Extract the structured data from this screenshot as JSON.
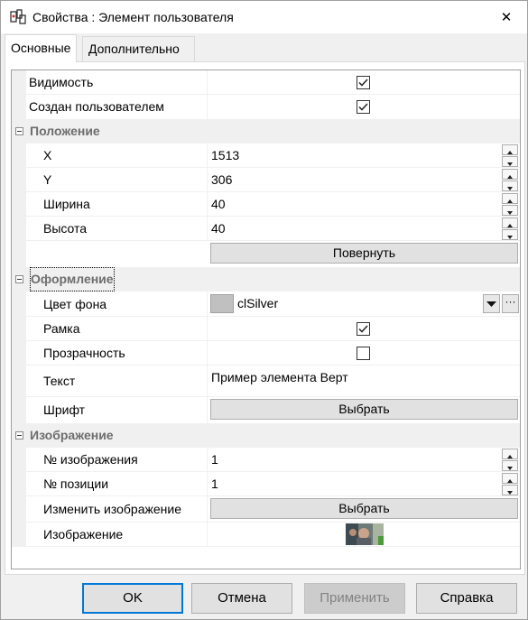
{
  "window": {
    "title": "Свойства : Элемент пользователя",
    "close_glyph": "✕"
  },
  "tabs": [
    {
      "label": "Основные",
      "active": true
    },
    {
      "label": "Дополнительно",
      "active": false
    }
  ],
  "grid": {
    "top_rows": [
      {
        "name": "Видимость",
        "checked": true
      },
      {
        "name": "Создан пользователем",
        "checked": true
      }
    ],
    "position": {
      "category": "Положение",
      "rows": [
        {
          "name": "X",
          "value": "1513"
        },
        {
          "name": "Y",
          "value": "306"
        },
        {
          "name": "Ширина",
          "value": "40"
        },
        {
          "name": "Высота",
          "value": "40"
        }
      ],
      "rotate_button": "Повернуть"
    },
    "appearance": {
      "category": "Оформление",
      "bg_color_name": "Цвет фона",
      "bg_color_value": "clSilver",
      "bg_color_hex": "#c0c0c0",
      "frame_name": "Рамка",
      "frame_checked": true,
      "transparency_name": "Прозрачность",
      "transparency_checked": false,
      "text_name": "Текст",
      "text_value": "Пример элемента Верт",
      "font_name": "Шрифт",
      "font_button": "Выбрать",
      "ellipsis": "···"
    },
    "image": {
      "category": "Изображение",
      "image_number_name": "№ изображения",
      "image_number_value": "1",
      "position_number_name": "№ позиции",
      "position_number_value": "1",
      "change_image_name": "Изменить изображение",
      "change_image_button": "Выбрать",
      "image_name": "Изображение"
    }
  },
  "buttons": {
    "ok": "OK",
    "cancel": "Отмена",
    "apply": "Применить",
    "help": "Справка"
  }
}
